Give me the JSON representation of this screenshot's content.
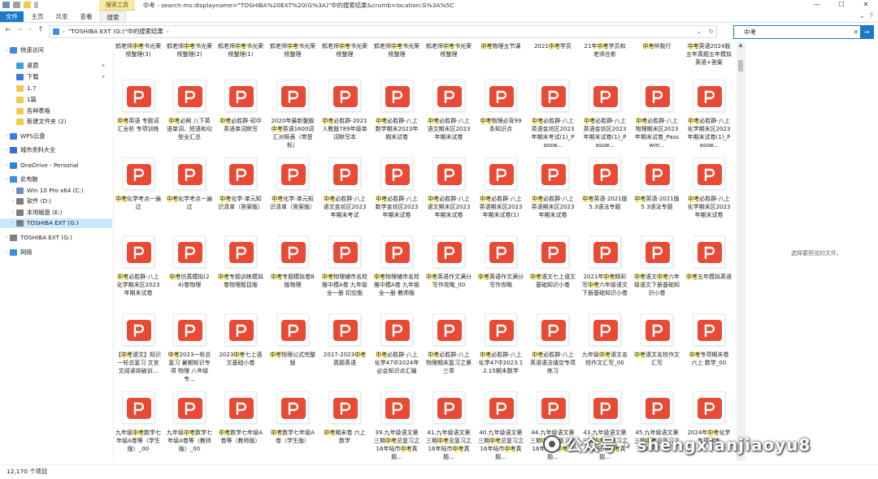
{
  "window": {
    "title": "中考 - search-ms:displayname=\"TOSHIBA%20EXT%20(G%3A)\"中的搜索结果&crumb=location:G%3A%5C",
    "search_tools_tab": "搜索工具",
    "controls": [
      "—",
      "☐",
      "✕"
    ]
  },
  "ribbon": {
    "tabs": [
      "文件",
      "主页",
      "共享",
      "查看",
      "搜索"
    ],
    "active": "搜索"
  },
  "address": {
    "path": "\"TOSHIBA EXT (G:)\"中的搜索结果",
    "chevron": "›"
  },
  "search": {
    "value": "中考"
  },
  "sidebar": {
    "items": [
      {
        "label": "快速访问",
        "level": 0,
        "icon": "star-icon",
        "color": "#3c8de0",
        "arrow": "⌄"
      },
      {
        "label": "桌面",
        "level": 1,
        "icon": "desktop-icon",
        "color": "#3ca0e8",
        "pin": true
      },
      {
        "label": "下载",
        "level": 1,
        "icon": "download-icon",
        "color": "#3a7bd5",
        "pin": true
      },
      {
        "label": "1.7",
        "level": 1,
        "icon": "folder-icon",
        "color": "#f2c94c"
      },
      {
        "label": "1篇",
        "level": 1,
        "icon": "folder-icon",
        "color": "#f2c94c"
      },
      {
        "label": "各种表格",
        "level": 1,
        "icon": "folder-icon",
        "color": "#f2c94c"
      },
      {
        "label": "新建文件夹 (2)",
        "level": 1,
        "icon": "folder-icon",
        "color": "#f2c94c"
      },
      {
        "label": "WPS云盘",
        "level": 0,
        "icon": "cloud-icon",
        "color": "#3b7de8",
        "arrow": "›"
      },
      {
        "label": "城市资料大全",
        "level": 0,
        "icon": "drive-icon",
        "color": "#2f6fd0",
        "arrow": "›"
      },
      {
        "label": "OneDrive - Personal",
        "level": 0,
        "icon": "onedrive-icon",
        "color": "#2a84d8",
        "arrow": "›"
      },
      {
        "label": "此电脑",
        "level": 0,
        "icon": "pc-icon",
        "color": "#3d8fd6",
        "arrow": "⌄"
      },
      {
        "label": "Win 10 Pro x64 (C:)",
        "level": 1,
        "icon": "disk-icon",
        "color": "#6b8fb8",
        "arrow": "›"
      },
      {
        "label": "软件 (D:)",
        "level": 1,
        "icon": "disk-icon",
        "color": "#7d7d7d",
        "arrow": "›"
      },
      {
        "label": "本地磁盘 (E:)",
        "level": 1,
        "icon": "disk-icon",
        "color": "#7d7d7d",
        "arrow": "›"
      },
      {
        "label": "TOSHIBA EXT (G:)",
        "level": 1,
        "icon": "disk-icon",
        "color": "#7d7d7d",
        "arrow": "›",
        "selected": true
      },
      {
        "label": "TOSHIBA EXT (G:)",
        "level": 0,
        "icon": "disk-icon",
        "color": "#7d7d7d",
        "arrow": "›"
      },
      {
        "label": "网络",
        "level": 0,
        "icon": "network-icon",
        "color": "#3d8fd6",
        "arrow": "›"
      }
    ]
  },
  "files": {
    "top_row": [
      "鹤老师中考书光荣榜整理(3)",
      "鹤老师中考书光荣榜整理(2)",
      "鹤老师中考书光荣榜整理(1)",
      "鹤老师中考书光荣榜整理",
      "鹤老师中考书光荣榜整理",
      "鹤老师中考书光荣榜整理",
      "鹤老师中考书光荣榜整理",
      "中考物理五节课",
      "2021中考学员",
      "21年中考学员和老师合影",
      "中考仲我行",
      "中考英语2024版 五年真题五年模拟英语+答案"
    ],
    "rows": [
      [
        "中考英语 专题词汇全析 专项训练",
        "中考必刷 八下英语单词、短语和句型全汇总",
        "中考必胜群-初中英语单词默写",
        "2020年最新整版中考英语1600词汇对照表（带音标）",
        "中考必胜群-2021人教版789年级单词默写本",
        "中考必胜群-八上数学期末2023年期末试卷",
        "中考必胜群-八上语文期末区2023年期末试卷",
        "中考物理必背99条知识点",
        "中考必胜群-八上英语金坊区2023年期末考试(1)_Passw...",
        "中考必胜群-八上英语金坊区2023年期末试卷(1)_Passw...",
        "中考必胜群-八上物理期末区2023年期末试卷_Passwor...",
        "中考必胜群-八上化学期末区2023年期末试卷(1)_Passw..."
      ],
      [
        "中考化学考点一遍过",
        "中考化学考点一遍过",
        "中考化学-单元知识清单（答案版）",
        "中考化学-单元知识清单（答案版）",
        "中考必胜群-八上语文金坊区2023年期末考试",
        "中考必胜群-八上数学金坊区2023年期末试卷",
        "中考必胜群-八上语文期末区2023年期末试卷",
        "中考必胜群-八上英语期末区2023年期末试卷(1)",
        "中考必胜群-八上英语期末区2023年期末试卷",
        "中考英语-2021版5.3语法专题",
        "中考英语-2021版5.3语法专题",
        "中考必胜群-八上化学期末区2023年期末试卷"
      ],
      [
        "中考必胜群-八上化学期末区2023年期末试卷",
        "中考仿真模拟(24)卷物理",
        "中考专题训练模拟卷物理题目版",
        "中考专题模拟卷B版物理",
        "中考物理辅市名校推中模A卷 九年级全一册 扣空版",
        "中考物理辅市名校推中模A卷 九年级全一册 教师版",
        "中考英语作文满分写作攻略_00",
        "中考英语作文满分写作攻略",
        "中考语文七上语文基础知识小卷",
        "2021年中考精彩写中考六年级语文下册基础知识小卷",
        "中考语文中考六年级语文下册基础知识小卷",
        "中考五年模拟英语"
      ],
      [
        "【中考语文】知识一轮总复习 文言文阅读突破训...",
        "中考2023一轮总复习 暑期知识专项 物理 八年级专...",
        "2023中考七上语文基础小卷",
        "中考物理公式完整版",
        "2017-2023中考真题英语",
        "中考必胜群-八上化学47中2024年必会知识点汇编",
        "中考必胜群-八上物理期末复习之第三章",
        "中考必胜群-八上化学47中2023.12.15期末数学",
        "中考必胜群-八上英语语法填空专项练习",
        "九年级中考语文名校作文汇写_00",
        "中考语文名校作文汇写",
        "中考专项期末卷 六上 数学_00"
      ],
      [
        "九年级中考数学七年级A卷等（学生版）_00",
        "九年级中考数学七年级A卷等（教师版）_00",
        "中考数学七年级A卷等（教师版）",
        "中考数学七年级A卷（学生版）",
        "中考期末卷 六上 数学",
        "39.九年级语文第三期中考总复习之16年陆市中考真题...",
        "41.九年级语文第三期中考总复习之16年陆市中考真题...",
        "40.九年级语文第三期中考总复习之16年陆市中考真题...",
        "44.九年级语文第三期中考总复习之16年陆市中考真题...",
        "43.九年级语文第三期中考总复习之16年陆市中考真题...",
        "45.九年级语文第三期中考总复习之第28季：大...",
        "2024年中考化学专项训练"
      ]
    ]
  },
  "preview": {
    "message": "选择要预览的文件。"
  },
  "status": {
    "count": "12,170 个项目"
  },
  "watermark": {
    "text": "公众号 · shengxianjiaoyu8"
  },
  "colors": {
    "accent": "#1979ca",
    "pdf_red": "#e84a35",
    "highlight": "#fbf3a0",
    "selected": "#cce8ff"
  }
}
